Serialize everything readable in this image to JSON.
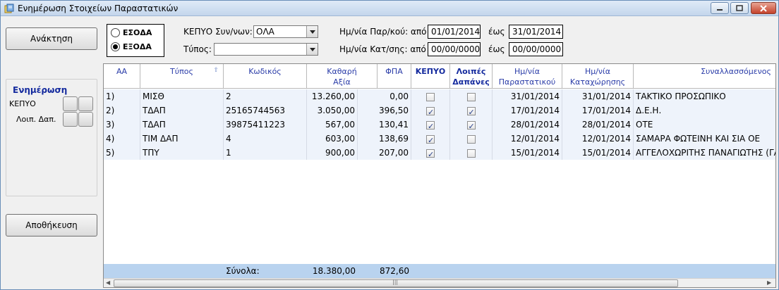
{
  "window": {
    "title": "Ενημέρωση Στοιχείων Παραστατικών",
    "controls": {
      "minimize": "minimize-icon",
      "maximize": "maximize-icon",
      "close": "close-icon"
    }
  },
  "left": {
    "retrieve_label": "Ανάκτηση",
    "update_title": "Ενημέρωση",
    "kepyo_label": "ΚΕΠΥΟ",
    "other_exp_label": "Λοιπ. Δαπ.",
    "save_label": "Αποθήκευση"
  },
  "direction": {
    "options": [
      {
        "label": "ΕΣΟΔΑ",
        "selected": false
      },
      {
        "label": "ΕΞΟΔΑ",
        "selected": true
      }
    ]
  },
  "filters": {
    "kepyo_label": "ΚΕΠΥΟ Συν/νων:",
    "kepyo_value": "ΟΛΑ",
    "type_label": "Τύπος:",
    "type_value": "",
    "doc_date_label": "Ημ/νία Παρ/κού: από",
    "doc_date_from": "01/01/2014",
    "doc_date_to_label": "έως",
    "doc_date_to": "31/01/2014",
    "reg_date_label": "Ημ/νία Κατ/σης: από",
    "reg_date_from": "00/00/0000",
    "reg_date_to_label": "έως",
    "reg_date_to": "00/00/0000"
  },
  "grid": {
    "columns": {
      "aa": "ΑΑ",
      "type": "Τύπος",
      "code": "Κωδικός",
      "net1": "Καθαρή",
      "net2": "Αξία",
      "vat": "ΦΠΑ",
      "kepyo": "ΚΕΠΥΟ",
      "other1": "Λοιπές",
      "other2": "Δαπάνες",
      "docdate1": "Ημ/νία",
      "docdate2": "Παραστατικού",
      "regdate1": "Ημ/νία",
      "regdate2": "Καταχώρησης",
      "party": "Συναλλασσόμενος"
    },
    "rows": [
      {
        "aa": "1)",
        "type": "ΜΙΣΘ",
        "code": "2",
        "net": "13.260,00",
        "vat": "0,00",
        "kepyo": false,
        "other": false,
        "docdate": "31/01/2014",
        "regdate": "31/01/2014",
        "party": "ΤΑΚΤΙΚΟ ΠΡΟΣΩΠΙΚΟ"
      },
      {
        "aa": "2)",
        "type": "ΤΔΑΠ",
        "code": "25165744563",
        "net": "3.050,00",
        "vat": "396,50",
        "kepyo": true,
        "other": true,
        "docdate": "17/01/2014",
        "regdate": "17/01/2014",
        "party": "Δ.Ε.Η."
      },
      {
        "aa": "3)",
        "type": "ΤΔΑΠ",
        "code": "39875411223",
        "net": "567,00",
        "vat": "130,41",
        "kepyo": true,
        "other": true,
        "docdate": "28/01/2014",
        "regdate": "28/01/2014",
        "party": "ΟΤΕ"
      },
      {
        "aa": "4)",
        "type": "ΤΙΜ ΔΑΠ",
        "code": "4",
        "net": "603,00",
        "vat": "138,69",
        "kepyo": true,
        "other": false,
        "docdate": "12/01/2014",
        "regdate": "12/01/2014",
        "party": "ΣΑΜΑΡΑ ΦΩΤΕΙΝΗ ΚΑΙ ΣΙΑ ΟΕ"
      },
      {
        "aa": "5)",
        "type": "ΤΠΥ",
        "code": "1",
        "net": "900,00",
        "vat": "207,00",
        "kepyo": true,
        "other": false,
        "docdate": "15/01/2014",
        "regdate": "15/01/2014",
        "party": "ΑΓΓΕΛΟΧΩΡΙΤΗΣ ΠΑΝΑΓΙΩΤΗΣ (ΓΑ"
      }
    ],
    "totals": {
      "label": "Σύνολα:",
      "net": "18.380,00",
      "vat": "872,60"
    }
  }
}
